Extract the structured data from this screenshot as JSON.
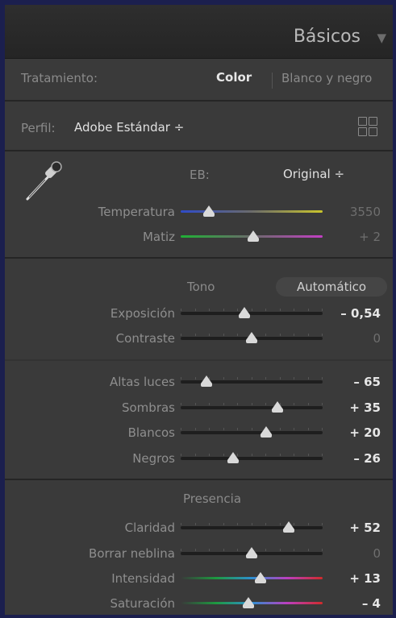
{
  "panel": {
    "title": "Básicos"
  },
  "treatment": {
    "label": "Tratamiento:",
    "color": "Color",
    "bw": "Blanco y negro"
  },
  "profile": {
    "label": "Perfil:",
    "value": "Adobe Estándar ÷"
  },
  "wb": {
    "label": "EB:",
    "value": "Original ÷"
  },
  "tone": {
    "label": "Tono",
    "auto": "Automático"
  },
  "presence": {
    "label": "Presencia"
  },
  "sliders": {
    "temperatura": {
      "label": "Temperatura",
      "value": "3550",
      "level": 0.2
    },
    "matiz": {
      "label": "Matiz",
      "value": "+ 2",
      "level": 0.51
    },
    "exposicion": {
      "label": "Exposición",
      "value": "– 0,54",
      "level": 0.45
    },
    "contraste": {
      "label": "Contraste",
      "value": "0",
      "level": 0.5
    },
    "altas": {
      "label": "Altas luces",
      "value": "– 65",
      "level": 0.18
    },
    "sombras": {
      "label": "Sombras",
      "value": "+ 35",
      "level": 0.68
    },
    "blancos": {
      "label": "Blancos",
      "value": "+ 20",
      "level": 0.6
    },
    "negros": {
      "label": "Negros",
      "value": "– 26",
      "level": 0.37
    },
    "claridad": {
      "label": "Claridad",
      "value": "+ 52",
      "level": 0.76
    },
    "neblina": {
      "label": "Borrar neblina",
      "value": "0",
      "level": 0.5
    },
    "intensidad": {
      "label": "Intensidad",
      "value": "+ 13",
      "level": 0.56
    },
    "saturacion": {
      "label": "Saturación",
      "value": "– 4",
      "level": 0.48
    }
  }
}
